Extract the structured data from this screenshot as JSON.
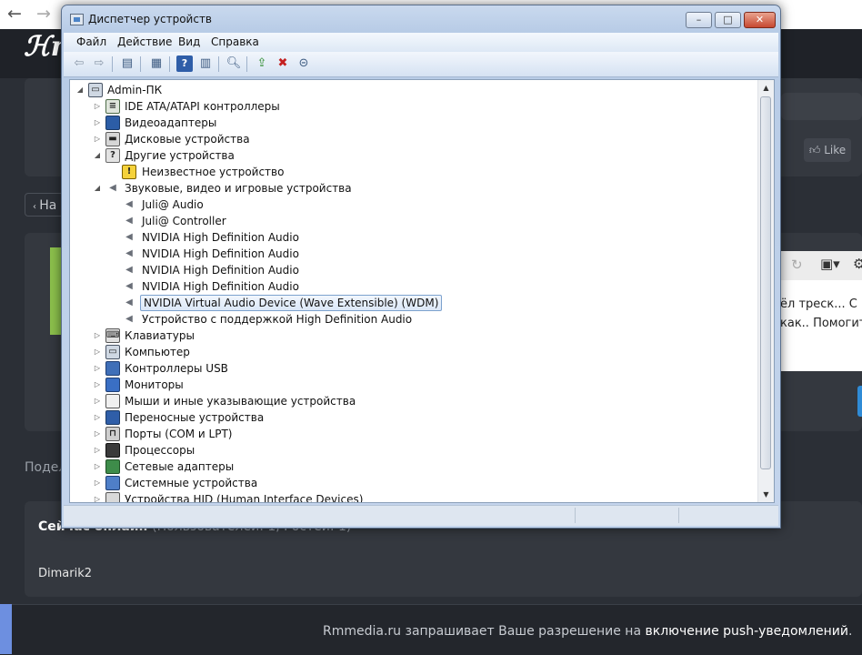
{
  "browser": {
    "back_glyph": "←",
    "forward_glyph": "→"
  },
  "site": {
    "logo": "ℋm",
    "like_label": "Like",
    "back_button_label": "На",
    "editor_lines": [
      "ёл треск... С",
      "как.. Помогит"
    ],
    "share_text": "Подел",
    "online_title": "Сейчас онлайн",
    "online_count": "(Пользователей: 1, Гостей: 1)",
    "online_user": "Dimarik2",
    "push_text_before": "Rmmedia.ru запрашивает Ваше разрешение на ",
    "push_text_bold": "включение push-уведомлений",
    "push_text_after": "."
  },
  "window": {
    "title": "Диспетчер устройств",
    "minimize": "–",
    "maximize": "□",
    "close": "✕",
    "menu": [
      "Файл",
      "Действие",
      "Вид",
      "Справка"
    ],
    "toolbar_icons": [
      "back-arrow-icon",
      "forward-arrow-icon",
      "show-hide-console-tree-icon",
      "properties-icon",
      "help-icon",
      "action-pane-icon",
      "scan-hardware-icon",
      "update-driver-icon",
      "uninstall-device-icon",
      "disable-device-icon"
    ]
  },
  "tree": {
    "root": "Admin-ПК",
    "nodes": [
      {
        "label": "Admin-ПК",
        "level": 0,
        "expander": "open",
        "icon": "computer-icon"
      },
      {
        "label": "IDE ATA/ATAPI контроллеры",
        "level": 1,
        "expander": "closed",
        "icon": "ide-controller-icon"
      },
      {
        "label": "Видеоадаптеры",
        "level": 1,
        "expander": "closed",
        "icon": "display-adapter-icon"
      },
      {
        "label": "Дисковые устройства",
        "level": 1,
        "expander": "closed",
        "icon": "disk-drive-icon"
      },
      {
        "label": "Другие устройства",
        "level": 1,
        "expander": "open",
        "icon": "other-devices-icon"
      },
      {
        "label": "Неизвестное устройство",
        "level": 2,
        "expander": "none",
        "icon": "unknown-device-warning-icon"
      },
      {
        "label": "Звуковые, видео и игровые устройства",
        "level": 1,
        "expander": "open",
        "icon": "speaker-icon"
      },
      {
        "label": "Juli@ Audio",
        "level": 2,
        "expander": "none",
        "icon": "speaker-icon"
      },
      {
        "label": "Juli@ Controller",
        "level": 2,
        "expander": "none",
        "icon": "speaker-icon"
      },
      {
        "label": "NVIDIA High Definition Audio",
        "level": 2,
        "expander": "none",
        "icon": "speaker-icon"
      },
      {
        "label": "NVIDIA High Definition Audio",
        "level": 2,
        "expander": "none",
        "icon": "speaker-icon"
      },
      {
        "label": "NVIDIA High Definition Audio",
        "level": 2,
        "expander": "none",
        "icon": "speaker-icon"
      },
      {
        "label": "NVIDIA High Definition Audio",
        "level": 2,
        "expander": "none",
        "icon": "speaker-icon"
      },
      {
        "label": "NVIDIA Virtual Audio Device (Wave Extensible) (WDM)",
        "level": 2,
        "expander": "none",
        "icon": "speaker-icon",
        "selected": true
      },
      {
        "label": "Устройство с поддержкой High Definition Audio",
        "level": 2,
        "expander": "none",
        "icon": "speaker-icon"
      },
      {
        "label": "Клавиатуры",
        "level": 1,
        "expander": "closed",
        "icon": "keyboard-icon"
      },
      {
        "label": "Компьютер",
        "level": 1,
        "expander": "closed",
        "icon": "computer-icon"
      },
      {
        "label": "Контроллеры USB",
        "level": 1,
        "expander": "closed",
        "icon": "usb-controller-icon"
      },
      {
        "label": "Мониторы",
        "level": 1,
        "expander": "closed",
        "icon": "monitor-icon"
      },
      {
        "label": "Мыши и иные указывающие устройства",
        "level": 1,
        "expander": "closed",
        "icon": "mouse-icon"
      },
      {
        "label": "Переносные устройства",
        "level": 1,
        "expander": "closed",
        "icon": "portable-device-icon"
      },
      {
        "label": "Порты (COM и LPT)",
        "level": 1,
        "expander": "closed",
        "icon": "port-icon"
      },
      {
        "label": "Процессоры",
        "level": 1,
        "expander": "closed",
        "icon": "processor-icon"
      },
      {
        "label": "Сетевые адаптеры",
        "level": 1,
        "expander": "closed",
        "icon": "network-adapter-icon"
      },
      {
        "label": "Системные устройства",
        "level": 1,
        "expander": "closed",
        "icon": "system-device-icon"
      },
      {
        "label": "Устройства HID (Human Interface Devices)",
        "level": 1,
        "expander": "closed",
        "icon": "hid-device-icon"
      }
    ]
  },
  "scrollbar": {
    "up": "▲",
    "down": "▼"
  },
  "colors": {
    "page_background": "#2b2f36",
    "accent_green": "#8cc14c",
    "selection_border": "#7da2ce",
    "window_frame": "#b7cbe6"
  }
}
